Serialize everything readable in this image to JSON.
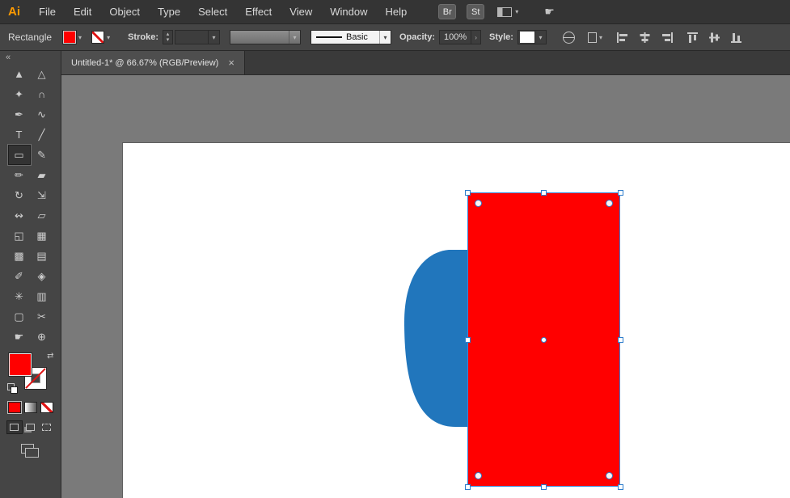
{
  "app": {
    "logo_text": "Ai"
  },
  "icons": {
    "dropdown_glyph": "▾",
    "stepper_up_glyph": "▴",
    "stepper_down_glyph": "▾",
    "flyout_glyph": "›",
    "hand_glyph": "☛",
    "swap_glyph": "⇄",
    "collapse_glyph": "«",
    "close_glyph": "×"
  },
  "menubar": {
    "items": [
      "File",
      "Edit",
      "Object",
      "Type",
      "Select",
      "Effect",
      "View",
      "Window",
      "Help"
    ],
    "bridge_badge": "Br",
    "stock_badge": "St"
  },
  "controlbar": {
    "tool_label": "Rectangle",
    "stroke_label": "Stroke:",
    "stroke_weight_value": "",
    "line_style_value": "Basic",
    "opacity_label": "Opacity:",
    "opacity_value": "100%",
    "style_label": "Style:"
  },
  "document_tab": {
    "title": "Untitled-1* @ 66.67% (RGB/Preview)"
  },
  "toolbar": {
    "tools": [
      {
        "name": "selection-tool",
        "glyph": "▲"
      },
      {
        "name": "direct-selection-tool",
        "glyph": "△"
      },
      {
        "name": "magic-wand-tool",
        "glyph": "✦"
      },
      {
        "name": "lasso-tool",
        "glyph": "∩"
      },
      {
        "name": "pen-tool",
        "glyph": "✒"
      },
      {
        "name": "curvature-tool",
        "glyph": "∿"
      },
      {
        "name": "type-tool",
        "glyph": "T"
      },
      {
        "name": "line-segment-tool",
        "glyph": "╱"
      },
      {
        "name": "rectangle-tool",
        "glyph": "▭",
        "selected": true
      },
      {
        "name": "paintbrush-tool",
        "glyph": "✎"
      },
      {
        "name": "pencil-tool",
        "glyph": "✏"
      },
      {
        "name": "eraser-tool",
        "glyph": "▰"
      },
      {
        "name": "rotate-tool",
        "glyph": "↻"
      },
      {
        "name": "scale-tool",
        "glyph": "⇲"
      },
      {
        "name": "width-tool",
        "glyph": "↭"
      },
      {
        "name": "free-transform-tool",
        "glyph": "▱"
      },
      {
        "name": "shape-builder-tool",
        "glyph": "◱"
      },
      {
        "name": "perspective-grid-tool",
        "glyph": "▦"
      },
      {
        "name": "mesh-tool",
        "glyph": "▩"
      },
      {
        "name": "gradient-tool",
        "glyph": "▤"
      },
      {
        "name": "eyedropper-tool",
        "glyph": "✐"
      },
      {
        "name": "blend-tool",
        "glyph": "◈"
      },
      {
        "name": "symbol-sprayer-tool",
        "glyph": "✳"
      },
      {
        "name": "column-graph-tool",
        "glyph": "▥"
      },
      {
        "name": "artboard-tool",
        "glyph": "▢"
      },
      {
        "name": "slice-tool",
        "glyph": "✂"
      },
      {
        "name": "hand-tool",
        "glyph": "☛"
      },
      {
        "name": "zoom-tool",
        "glyph": "⊕"
      }
    ]
  },
  "colors": {
    "fill_red": "#ff0000",
    "shape_blue": "#2176bc",
    "selection_blue": "#3a85d8",
    "logo_orange": "#ff9a00",
    "pasteboard_gray": "#7a7a7a",
    "artboard_white": "#ffffff"
  },
  "canvas": {
    "zoom": "66.67%",
    "color_mode": "RGB/Preview",
    "selected_shape": "red rectangle",
    "background_shape": "blue rounded blob"
  }
}
